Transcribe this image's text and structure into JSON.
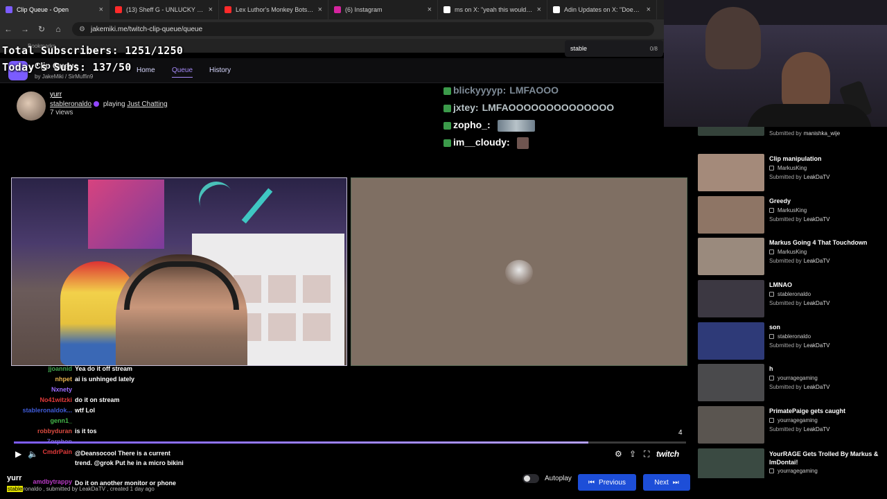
{
  "browser": {
    "tabs": [
      {
        "title": "Clip Queue - Open",
        "color": "#7c5cff",
        "active": true
      },
      {
        "title": "(13) Sheff G - UNLUCKY LUCKY",
        "color": "#ff2a2a"
      },
      {
        "title": "Lex Luthor's Monkey Bots | SUP",
        "color": "#ff2a2a"
      },
      {
        "title": "(6) Instagram",
        "color": "#d6249f"
      },
      {
        "title": "ms on X: \"yeah this would be m",
        "color": "#ffffff"
      },
      {
        "title": "Adin Updates on X: \"Doechii se",
        "color": "#ffffff"
      }
    ],
    "url": "jakemiki.me/twitch-clip-queue/queue",
    "bookmarks_label": "Bookmarks"
  },
  "overlay": {
    "total_subs": "Total Subscribers: 1251/1250",
    "today_subs": "Today's Subs: 137/50"
  },
  "app": {
    "title": "Clip Queue",
    "by": "by",
    "author1": "JakeMiki",
    "author2": "SirMuffin9",
    "nav": [
      "Home",
      "Queue",
      "History"
    ],
    "search_value": "stable",
    "search_count": "0/8"
  },
  "clip": {
    "title": "yurr",
    "channel": "stableronaldo",
    "playing": "playing",
    "category": "Just Chatting",
    "views": "7 views",
    "submitted_meta_user": "stable",
    "submitted_meta_rest": "ronaldo , submitted by LeakDaTV , created 1 day ago"
  },
  "stream_chat": [
    {
      "user": "blickyyyyp:",
      "msg": "LMFAOOO",
      "color": "#7e8b97"
    },
    {
      "user": "jxtey:",
      "msg": "LMFAOOOOOOOOOOOOOO",
      "color": "#b9c4c8"
    },
    {
      "user": "zopho_:",
      "msg": "",
      "color": "#ffffff"
    },
    {
      "user": "im__cloudy:",
      "msg": "",
      "color": "#ffffff"
    }
  ],
  "chat": [
    {
      "user": "jjoannid",
      "msg": "Yea do it off stream",
      "color": "#3fa34d"
    },
    {
      "user": "nhpet",
      "msg": "ai is unhinged lately",
      "color": "#e6b350"
    },
    {
      "user": "Nxnety",
      "msg": "",
      "color": "#9c6cff"
    },
    {
      "user": "No41witzki",
      "msg": "do it on stream",
      "color": "#e03a3a"
    },
    {
      "user": "stableronaldok...",
      "msg": "wtf Lol",
      "color": "#3f5bd6"
    },
    {
      "user": "genn1_",
      "msg": "",
      "color": "#45b84a"
    },
    {
      "user": "robbyduran",
      "msg": "is it tos",
      "color": "#d94a3f"
    },
    {
      "user": "Zorphon",
      "msg": "",
      "color": "#6a5bb8"
    },
    {
      "user": "CmdrPain",
      "msg": "@Deansocool There is a current trend. @grok Put he in a micro bikini",
      "color": "#e03a3a"
    },
    {
      "user": "amdbytrappy",
      "msg": "Do it on another monitor or phone",
      "color": "#b83ac4"
    }
  ],
  "player": {
    "progress": 0.855,
    "counter": "4",
    "brand": "twitch",
    "autoplay_label": "Autoplay",
    "previous_label": "Previous",
    "next_label": "Next"
  },
  "queue": [
    {
      "title": "",
      "channel": "",
      "submitter_prefix": "Submitted by",
      "submitter": "manishka_wije",
      "thumb": "#34423a"
    },
    {
      "title": "Clip manipulation",
      "channel": "MarkusKing",
      "submitter_prefix": "Submitted by",
      "submitter": "LeakDaTV",
      "thumb": "#a48a7a"
    },
    {
      "title": "Greedy",
      "channel": "MarkusKing",
      "submitter_prefix": "Submitted by",
      "submitter": "LeakDaTV",
      "thumb": "#8e7565"
    },
    {
      "title": "Markus Going 4 That Touchdown",
      "channel": "MarkusKing",
      "submitter_prefix": "Submitted by",
      "submitter": "LeakDaTV",
      "thumb": "#9a8a7d"
    },
    {
      "title": "LMNAO",
      "channel": "stableronaldo",
      "submitter_prefix": "Submitted by",
      "submitter": "LeakDaTV",
      "thumb": "#3c3842"
    },
    {
      "title": "son",
      "channel": "stableronaldo",
      "submitter_prefix": "Submitted by",
      "submitter": "LeakDaTV",
      "thumb": "#2e3a78"
    },
    {
      "title": "h",
      "channel": "yourragegaming",
      "submitter_prefix": "Submitted by",
      "submitter": "LeakDaTV",
      "thumb": "#4a4a4c"
    },
    {
      "title": "PrimatePaige gets caught",
      "channel": "yourragegaming",
      "submitter_prefix": "Submitted by",
      "submitter": "LeakDaTV",
      "thumb": "#5a5550"
    },
    {
      "title": "YourRAGE Gets Trolled By Markus & ImDontai!",
      "channel": "yourragegaming",
      "submitter_prefix": "",
      "submitter": "",
      "thumb": "#3a4a42"
    }
  ]
}
